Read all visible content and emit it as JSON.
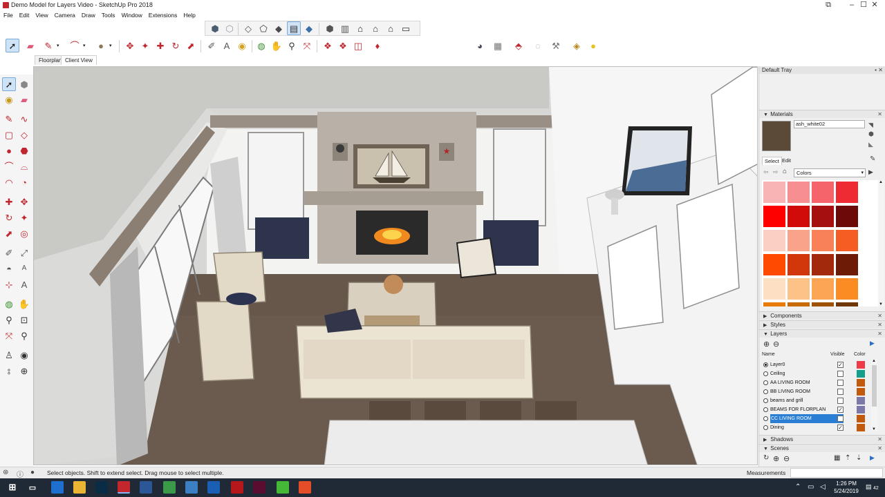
{
  "window": {
    "title": "Demo Model for Layers Video - SketchUp Pro 2018",
    "controls": [
      "restore-down",
      "minimize",
      "maximize",
      "close"
    ]
  },
  "menu": [
    "File",
    "Edit",
    "View",
    "Camera",
    "Draw",
    "Tools",
    "Window",
    "Extensions",
    "Help"
  ],
  "scene_tabs": [
    {
      "label": "Floorplan",
      "active": false
    },
    {
      "label": "Client View",
      "active": true
    }
  ],
  "toolbar_icons": {
    "views": [
      "iso-view-icon",
      "top-view-icon",
      "front-view-icon",
      "right-view-icon",
      "back-view-icon",
      "left-view-icon"
    ],
    "styles": [
      "xray-icon",
      "back-edges-icon",
      "wireframe-icon",
      "hidden-line-icon",
      "shaded-icon"
    ],
    "main": [
      "select-icon",
      "eraser-icon",
      "line-icon",
      "arc-icon",
      "shape-icon",
      "push-pull-icon",
      "follow-me-icon",
      "move-icon",
      "rotate-icon",
      "scale-icon",
      "offset-icon",
      "tape-measure-icon",
      "dimension-icon",
      "protractor-icon",
      "text-icon",
      "axes-icon",
      "3d-text-icon",
      "paint-bucket-icon",
      "orbit-icon",
      "pan-icon",
      "zoom-icon",
      "zoom-extents-icon",
      "warehouse-icon",
      "extension-warehouse-icon",
      "send-to-layout-icon",
      "ruby-icon"
    ],
    "right": [
      "photo-textures-icon",
      "add-location-icon",
      "geo-location-icon",
      "toggle-terrain-icon",
      "sandbox-icon",
      "component-icon",
      "light-icon"
    ]
  },
  "tray": {
    "title": "Default Tray",
    "materials": {
      "header": "Materials",
      "current_name": "ash_white02",
      "tabs": [
        "Select",
        "Edit"
      ],
      "library": "Colors",
      "swatch_colors": [
        "#f8b4b4",
        "#f78f92",
        "#f4646a",
        "#ee2a33",
        "#ff0000",
        "#d10a0a",
        "#a50f0f",
        "#6c0a0a",
        "#fccfc5",
        "#f9a48a",
        "#f98157",
        "#f65d23",
        "#ff4a00",
        "#d2370b",
        "#a2290c",
        "#6d1a06",
        "#fde0c4",
        "#fcc288",
        "#fca555",
        "#fb8c23",
        "#e87b09",
        "#c86a06",
        "#9e5205",
        "#6e3703"
      ]
    },
    "sections": [
      "Components",
      "Styles",
      "Layers",
      "Shadows",
      "Scenes"
    ],
    "layers": {
      "col_name": "Name",
      "col_visible": "Visible",
      "col_color": "Color",
      "rows": [
        {
          "name": "Layer0",
          "active": true,
          "visible": true,
          "color": "#ef3a4a"
        },
        {
          "name": "Ceiling",
          "active": false,
          "visible": false,
          "color": "#149e8c"
        },
        {
          "name": "AA LIVING ROOM",
          "active": false,
          "visible": false,
          "color": "#c25a0b"
        },
        {
          "name": "BB LIVING ROOM",
          "active": false,
          "visible": false,
          "color": "#c25a0b"
        },
        {
          "name": "beams and grill",
          "active": false,
          "visible": false,
          "color": "#7b7aa6"
        },
        {
          "name": "BEAMS FOR FLORPLAN",
          "active": false,
          "visible": true,
          "color": "#7c79a8"
        },
        {
          "name": "CC LIVING ROOM",
          "active": false,
          "visible": false,
          "color": "#c25a0b",
          "selected": true
        },
        {
          "name": "Dining",
          "active": false,
          "visible": true,
          "color": "#c25a0b"
        }
      ]
    }
  },
  "status": {
    "message": "Select objects. Shift to extend select. Drag mouse to select multiple.",
    "measurements_label": "Measurements"
  },
  "taskbar": {
    "time": "1:26 PM",
    "date": "5/24/2019",
    "notification_count": "42",
    "apps": [
      {
        "name": "edge",
        "color": "#1f6fd1",
        "glyph": "e"
      },
      {
        "name": "file-explorer",
        "color": "#e8b634",
        "glyph": ""
      },
      {
        "name": "photoshop",
        "color": "#0b2c45",
        "glyph": "Ps"
      },
      {
        "name": "sketchup",
        "color": "#c4262e",
        "glyph": ""
      },
      {
        "name": "word",
        "color": "#2b5797",
        "glyph": "W"
      },
      {
        "name": "chrome",
        "color": "#3a9a4a",
        "glyph": ""
      },
      {
        "name": "rider",
        "color": "#3c7fc3",
        "glyph": ""
      },
      {
        "name": "outlook",
        "color": "#1a5fb4",
        "glyph": "O"
      },
      {
        "name": "acrobat",
        "color": "#b5171b",
        "glyph": ""
      },
      {
        "name": "indesign",
        "color": "#5a0d2e",
        "glyph": "Id"
      },
      {
        "name": "camtasia",
        "color": "#46b838",
        "glyph": "C"
      },
      {
        "name": "camtasia-recorder",
        "color": "#e54c28",
        "glyph": "C"
      }
    ]
  }
}
